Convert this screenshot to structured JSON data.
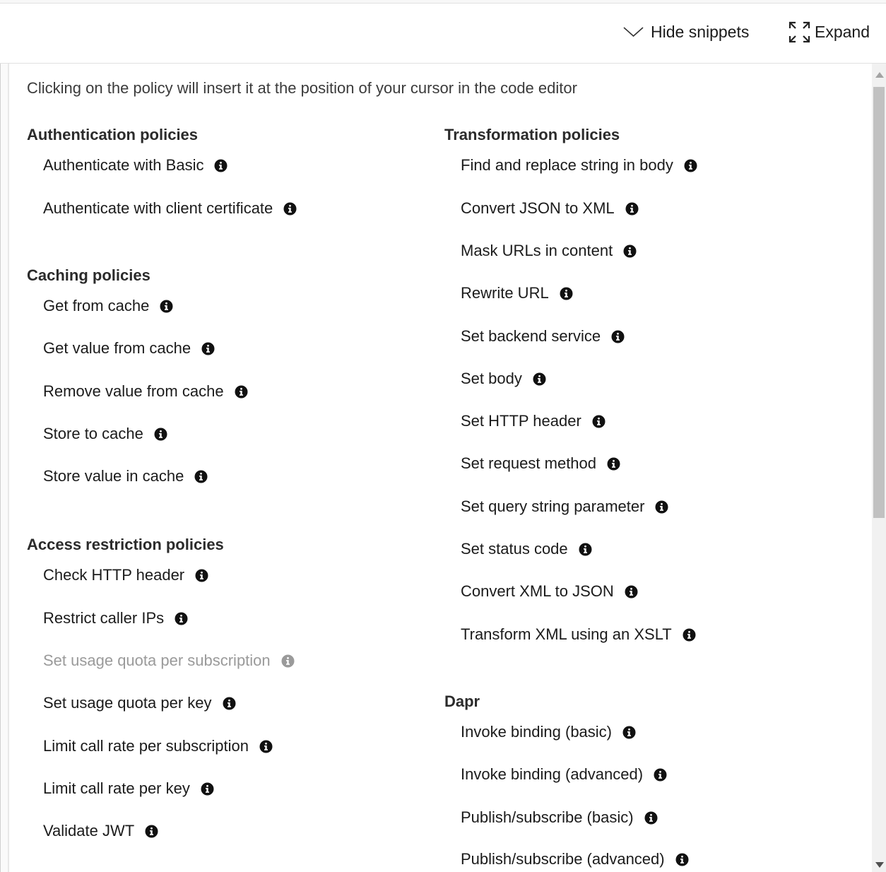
{
  "toolbar": {
    "hide_label": "Hide snippets",
    "expand_label": "Expand"
  },
  "intro": "Clicking on the policy will insert it at the position of your cursor in the code editor",
  "left": {
    "auth": {
      "title": "Authentication policies",
      "items": [
        "Authenticate with Basic",
        "Authenticate with client certificate"
      ]
    },
    "caching": {
      "title": "Caching policies",
      "items": [
        "Get from cache",
        "Get value from cache",
        "Remove value from cache",
        "Store to cache",
        "Store value in cache"
      ]
    },
    "access": {
      "title": "Access restriction policies",
      "items": [
        "Check HTTP header",
        "Restrict caller IPs",
        "Set usage quota per subscription",
        "Set usage quota per key",
        "Limit call rate per subscription",
        "Limit call rate per key",
        "Validate JWT"
      ]
    }
  },
  "right": {
    "transform": {
      "title": "Transformation policies",
      "items": [
        "Find and replace string in body",
        "Convert JSON to XML",
        "Mask URLs in content",
        "Rewrite URL",
        "Set backend service",
        "Set body",
        "Set HTTP header",
        "Set request method",
        "Set query string parameter",
        "Set status code",
        "Convert XML to JSON",
        "Transform XML using an XSLT"
      ]
    },
    "dapr": {
      "title": "Dapr",
      "items": [
        "Invoke binding (basic)",
        "Invoke binding (advanced)",
        "Publish/subscribe (basic)",
        "Publish/subscribe (advanced)"
      ]
    }
  },
  "colors": {
    "text": "#1b1b1b",
    "disabled": "#9a9a9a",
    "border": "#e1e1e1"
  },
  "icons": {
    "info": "info-circle-icon",
    "hide": "chevron-down-icon",
    "expand": "expand-arrows-icon"
  }
}
